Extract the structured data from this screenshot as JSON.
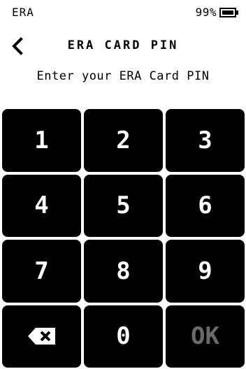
{
  "status_bar": {
    "carrier": "ERA",
    "battery_percent": "99%",
    "battery_icon": "battery-full-icon"
  },
  "header": {
    "back_icon": "chevron-left-icon",
    "title": "ERA CARD PIN"
  },
  "prompt": "Enter your ERA Card PIN",
  "keypad": {
    "keys": [
      "1",
      "2",
      "3",
      "4",
      "5",
      "6",
      "7",
      "8",
      "9"
    ],
    "delete_icon": "backspace-icon",
    "zero": "0",
    "ok": "OK",
    "ok_enabled": false
  },
  "colors": {
    "key_background": "#000000",
    "key_text": "#ffffff",
    "key_disabled_text": "#6a6a6a",
    "page_background": "#ffffff"
  }
}
